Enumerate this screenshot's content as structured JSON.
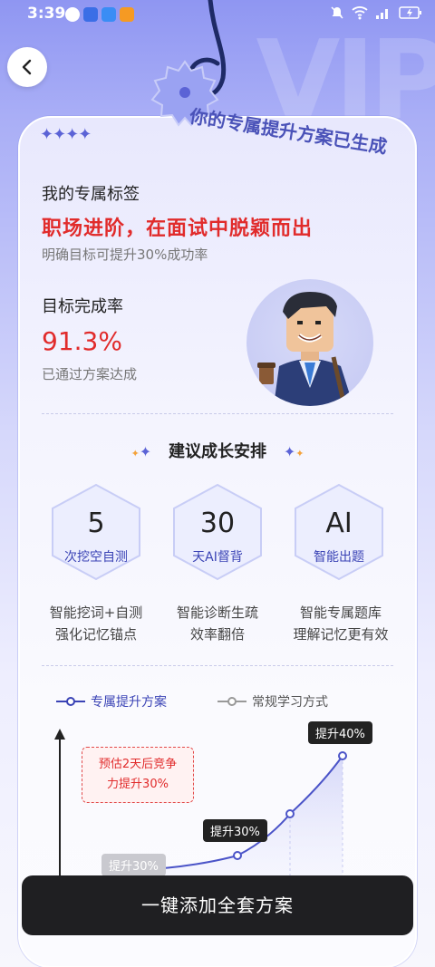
{
  "status_bar": {
    "time": "3:39",
    "battery_icon": "battery-charging-icon"
  },
  "header": {
    "badge_text": "你的专属提升方案已生成"
  },
  "profile": {
    "tag_label": "我的专属标签",
    "headline": "职场进阶，在面试中脱颖而出",
    "headline_sub": "明确目标可提升30%成功率",
    "rate_label": "目标完成率",
    "rate_value": "91.3%",
    "rate_sub": "已通过方案达成"
  },
  "plan": {
    "section_title": "建议成长安排",
    "items": [
      {
        "num": "5",
        "label": "次挖空自测",
        "desc1": "智能挖词+自测",
        "desc2": "强化记忆锚点"
      },
      {
        "num": "30",
        "label": "天AI督背",
        "desc1": "智能诊断生疏",
        "desc2": "效率翻倍"
      },
      {
        "num": "AI",
        "label": "智能出题",
        "desc1": "智能专属题库",
        "desc2": "理解记忆更有效"
      }
    ]
  },
  "chart": {
    "legend_exclusive": "专属提升方案",
    "legend_regular": "常规学习方式",
    "callout_line1": "预估2天后竞争",
    "callout_line2": "力提升30%",
    "tip_top": "提升40%",
    "tip_mid": "提升30%",
    "tip_low": "提升30%"
  },
  "chart_data": {
    "type": "line",
    "title": "",
    "series": [
      {
        "name": "专属提升方案",
        "labels": [
          "提升30%",
          "提升40%"
        ]
      },
      {
        "name": "常规学习方式",
        "labels": [
          "提升30%"
        ]
      }
    ]
  },
  "cta": {
    "label": "一键添加全套方案"
  },
  "colors": {
    "accent": "#5b63d6",
    "highlight_red": "#e12b2b",
    "cta_bg": "#1f1f22"
  }
}
